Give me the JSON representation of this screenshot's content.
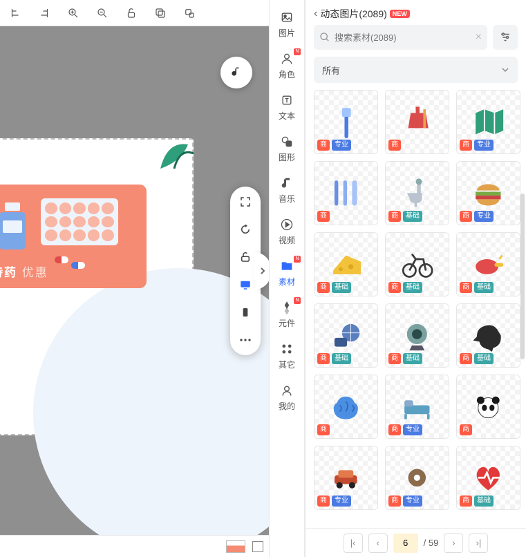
{
  "toolbar": {
    "items": [
      "align-left",
      "align-right",
      "zoom-in",
      "zoom-out",
      "unlock",
      "copy",
      "paste-style"
    ]
  },
  "canvas": {
    "card_title": "特药",
    "card_sub": "优惠",
    "clipped_text": "惠"
  },
  "float_tools": [
    "fullscreen",
    "rotate",
    "unlock",
    "desktop",
    "mobile",
    "more"
  ],
  "categories": [
    {
      "key": "image",
      "label": "图片",
      "new": false
    },
    {
      "key": "character",
      "label": "角色",
      "new": true
    },
    {
      "key": "text",
      "label": "文本",
      "new": false
    },
    {
      "key": "shape",
      "label": "图形",
      "new": false
    },
    {
      "key": "music",
      "label": "音乐",
      "new": false
    },
    {
      "key": "video",
      "label": "视频",
      "new": false
    },
    {
      "key": "material",
      "label": "素材",
      "new": true,
      "active": true
    },
    {
      "key": "component",
      "label": "元件",
      "new": true
    },
    {
      "key": "other",
      "label": "其它",
      "new": false
    },
    {
      "key": "mine",
      "label": "我的",
      "new": false
    }
  ],
  "panel": {
    "breadcrumb": "动态图片(2089)",
    "new_label": "NEW",
    "search_placeholder": "搜索素材(2089)",
    "dropdown": "所有",
    "tag_biz": "商",
    "tag_pro": "专业",
    "tag_basic": "基础",
    "page_current": "6",
    "page_total": "/ 59",
    "assets": [
      {
        "name": "toothbrush",
        "color": "#4b7ae2",
        "tags": [
          "biz",
          "pro"
        ]
      },
      {
        "name": "dustpan",
        "color": "#d94b4b",
        "tags": [
          "biz"
        ]
      },
      {
        "name": "map",
        "color": "#2f9e7a",
        "tags": [
          "biz",
          "pro"
        ]
      },
      {
        "name": "utensils",
        "color": "#6b8fe2",
        "tags": [
          "biz"
        ]
      },
      {
        "name": "faucet",
        "color": "#b9c4d0",
        "tags": [
          "biz",
          "basic"
        ]
      },
      {
        "name": "burger",
        "color": "#e2a24b",
        "tags": [
          "biz",
          "pro"
        ]
      },
      {
        "name": "cheese",
        "color": "#f2c23a",
        "tags": [
          "biz",
          "basic"
        ]
      },
      {
        "name": "bicycle",
        "color": "#3a3a3a",
        "tags": [
          "biz",
          "basic"
        ]
      },
      {
        "name": "meat",
        "color": "#e24b4b",
        "tags": [
          "biz",
          "basic"
        ]
      },
      {
        "name": "camera-globe",
        "color": "#5a7fbf",
        "tags": [
          "biz",
          "basic"
        ]
      },
      {
        "name": "webcam",
        "color": "#7aa0a0",
        "tags": [
          "biz",
          "basic"
        ]
      },
      {
        "name": "crow",
        "color": "#2b2b2b",
        "tags": [
          "biz",
          "basic"
        ]
      },
      {
        "name": "brain",
        "color": "#4b8fe2",
        "tags": [
          "biz"
        ]
      },
      {
        "name": "bed",
        "color": "#5aa0c2",
        "tags": [
          "biz",
          "pro"
        ]
      },
      {
        "name": "panda",
        "color": "#1a1a1a",
        "tags": [
          "biz"
        ]
      },
      {
        "name": "car",
        "color": "#c24b2f",
        "tags": [
          "biz",
          "pro"
        ]
      },
      {
        "name": "donut",
        "color": "#8a6b4b",
        "tags": [
          "biz",
          "pro"
        ]
      },
      {
        "name": "heartbeat",
        "color": "#e23a3a",
        "tags": [
          "biz",
          "basic"
        ]
      }
    ]
  }
}
